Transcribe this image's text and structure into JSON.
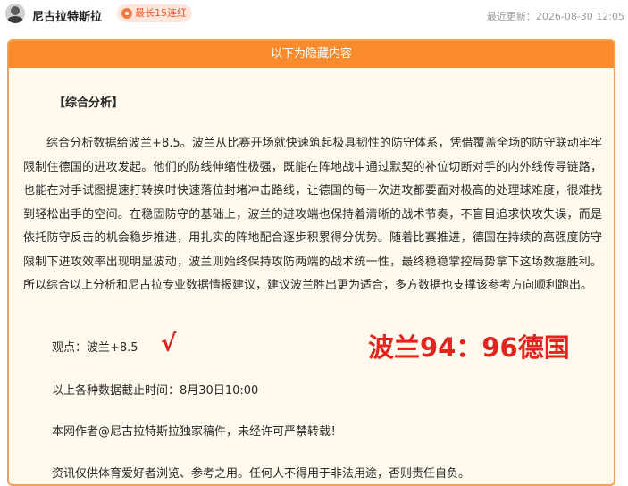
{
  "header": {
    "author": "尼古拉特斯拉",
    "streak_badge": "最长15连红",
    "updated_label": "最近更新",
    "updated_time": "2026-08-30 12:05",
    "accent": "#f98b2c"
  },
  "panel": {
    "banner": "以下为隐藏内容",
    "section_title": "【综合分析】",
    "analysis": "综合分析数据给波兰+8.5。波兰从比赛开场就快速筑起极具韧性的防守体系，凭借覆盖全场的防守联动牢牢限制住德国的进攻发起。他们的防线伸缩性极强，既能在阵地战中通过默契的补位切断对手的内外线传导链路，也能在对手试图提速打转换时快速落位封堵冲击路线，让德国的每一次进攻都要面对极高的处理球难度，很难找到轻松出手的空间。在稳固防守的基础上，波兰的进攻端也保持着清晰的战术节奏，不盲目追求快攻失误，而是依托防守反击的机会稳步推进，用扎实的阵地配合逐步积累得分优势。随着比赛推进，德国在持续的高强度防守限制下进攻效率出现明显波动，波兰则始终保持攻防两端的战术统一性，最终稳稳掌控局势拿下这场数据胜利。所以综合以上分析和尼古拉专业数据情报建议，建议波兰胜出更为适合，多方数据也支撑该参考方向顺利跑出。",
    "view_label": "观点：",
    "view_pick": "波兰+8.5",
    "check_mark": "√",
    "final_score": "波兰94：96德国",
    "data_cutoff_label": "以上各种数据截止时间：",
    "data_cutoff_value": "8月30日10:00",
    "copyright": "本网作者@尼古拉特斯拉独家稿件，未经许可严禁转载！",
    "disclaimer": "资讯仅供体育爱好者浏览、参考之用。任何人不得用于非法用途，否则责任自负。"
  }
}
